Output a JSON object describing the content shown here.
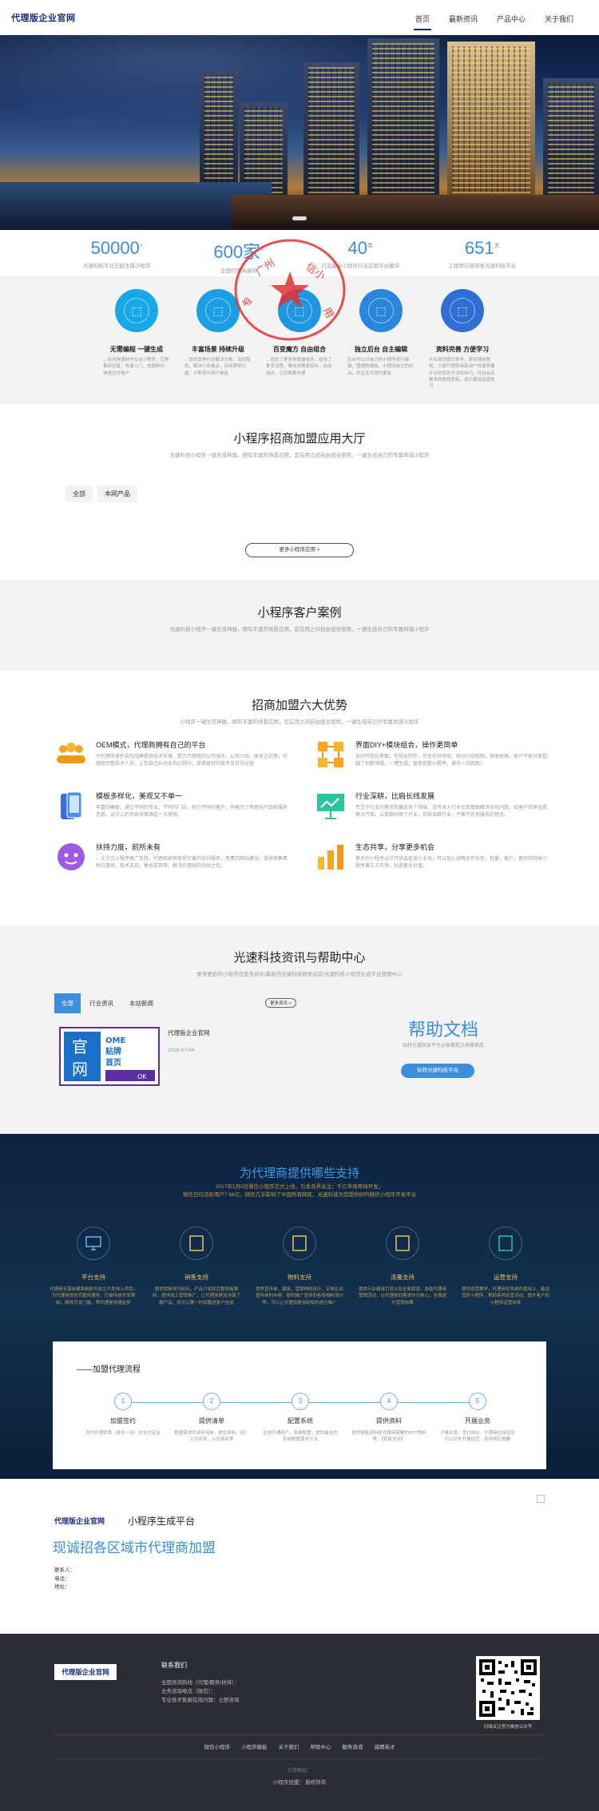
{
  "header": {
    "logo": "代理版企业官网",
    "nav": [
      "首页",
      "最新资讯",
      "产品中心",
      "关于我们"
    ]
  },
  "stats": [
    {
      "num": "50000",
      "sup": "+",
      "desc": "光速科技平台已经生成小程序"
    },
    {
      "num": "600家",
      "sup": "+",
      "desc": "全国代理商遍布"
    },
    {
      "num": "40",
      "sup": "类",
      "desc": "打造最全小程序行业应用平台模块"
    },
    {
      "num": "651",
      "sup": "天",
      "desc": "工程师日夜研发光速科技平台"
    }
  ],
  "features": [
    {
      "title": "无需编程 一键生成",
      "desc": "，在线快速制作生成小程序，完美集现设备；快速入门，快速制作，快速交付客户",
      "color": "#18a8e8"
    },
    {
      "title": "丰富场景 持续升级",
      "desc": "，提供百种行业解决方案，深挖需求，解决行业痛点，持续更新功能，不断提升用户体验",
      "color": "#1a9ee6"
    },
    {
      "title": "百变魔方 自由组合",
      "desc": "，提供了更多更便捷组件，提供了更多设置，模块间随意组合，自由组合，让页面更丰满",
      "color": "#2196e0"
    },
    {
      "title": "独立后台 自主编辑",
      "desc": "后台可以对自己的小程序进行编辑，管理的编辑，小程序独立的后台，并且在可随时更新",
      "color": "#2a86dc"
    },
    {
      "title": "资料完善 方便学习",
      "desc": "不仅提供图文教学，更有视频教程，方便代理和商家用户快速掌握平台的使用方法和技巧，并且会有更多的教程更新，成功使用运营技巧",
      "color": "#2f6fd4"
    }
  ],
  "seal": {
    "top": "广州信小",
    "bottom": "专用章"
  },
  "app_hall": {
    "title": "小程序招商加盟应用大厅",
    "subtitle": "光速科技小程序一键生成神器，拥有丰富的场景应用，您在用之间自由组合使用，一键生成自己的专属商城小程序",
    "tabs": [
      "全部",
      "本网产品"
    ],
    "more": "更多小程序应用 >"
  },
  "cases": {
    "title": "小程序客户案例",
    "subtitle": "光速科技小程序一键生成神器，拥有丰富的场景应用，您在用之间自由组合使用，一键生成自己的专属商城小程序"
  },
  "advantages": {
    "title": "招商加盟六大优势",
    "subtitle": "小程序一键生成神器，拥有丰富的场景应用，您在用之间自由组合使用，一键生成自己的专属商城小程序",
    "items": [
      {
        "title": "OEM模式，代理商拥有自己的平台",
        "desc": "为代理商保护自我品牌提供技术支撑，提示代理商的公司域名，公司介绍，联系方式等，代理商完整技术人员，让您自己从创业的过程中，获得更好的技术支持与运营",
        "icon": "users-icon"
      },
      {
        "title": "界面DIY+模块组合，操作更简单",
        "desc": "自创可视化界面，可视化制作，完全实时预览，拖动分组机制，快速拖拽，客户不能分享超越了创新领域，一键生成，智能搭配小程序，操作一站到底！",
        "icon": "modules-icon"
      },
      {
        "title": "模板多样化，美观又不单一",
        "desc": "丰富的模板，通过不同的专业，不同的门店，吸引不同的客户，并展示了两者的产品和服务信息。设计上的布局多面满足一大美观。",
        "icon": "mobile-template-icon"
      },
      {
        "title": "行业深耕，比肩长线发展",
        "desc": "专注于行业的需求和痛点各个领域，没有深入行业优良基础解决实际问题，给客户带来优质解决方案。认真做好每个行业，持续深耕行业，不懈不怠地服务的理念。",
        "icon": "presentation-icon"
      },
      {
        "title": "扶持力度，前所未有",
        "desc": "，全方位小程序推广支持，代理商能够享受完善的培训服务，免费的网站建设，提供销售素材与营销，技术支持，售后支持等。解决代理商的后顾之忧。",
        "icon": "support-agent-icon"
      },
      {
        "title": "生态共享，分享更多机会",
        "desc": "更多的小程序设计开放会促进小业务，可以加入战略合作伙伴，批量，客户，更好的持续小程序第三方市场，创造更多价值。",
        "icon": "growth-chart-icon"
      }
    ]
  },
  "news": {
    "title": "光速科技资讯与帮助中心",
    "subtitle": "更多更新的小程序信息告诉你/最新的光速科技研发动态/光速科技小程序生成平台使用中心",
    "tabs": [
      "全部",
      "行业资讯",
      "本站新闻"
    ],
    "more": "更多资讯 >",
    "card": {
      "image_text": [
        "官",
        "网",
        "OME",
        "贴牌",
        "首页",
        "OK"
      ],
      "title": "代理版企业官网",
      "date": "2018-07-04"
    },
    "help": {
      "title": "帮助文档",
      "subtitle": "玩转光速科技平台必备教程文档搜索库",
      "button": "玩转光速科技平台"
    }
  },
  "agent_support": {
    "title": "为代理商提供哪些支持",
    "subtitle_lines": [
      "2017年1月9日微信小程序正式上线，引发各界关注；千亿市场等待开发，",
      "微信日均活跃用户7.68亿，微信几乎影响了中国所有网民，光速科技为您提供好的微信小程序开发平台"
    ],
    "items": [
      {
        "title": "平台支持",
        "desc": "代理商无需自建系统即可自主开发线上项目，为代理商提供完整的服务，打破传统开发限制，降低开发门槛，帮代理商快速起步",
        "icon": "monitor-icon"
      },
      {
        "title": "销售支持",
        "desc": "提供销售技巧培训，产品介绍和完整销售物料，提供线上营销推广，让代理商更加全面了解产品，并可以第一时间跟进客户信息",
        "icon": "chart-card-icon"
      },
      {
        "title": "物料支持",
        "desc": "提供宣传单、展架、营销物料设计，定制企业宣传册的内容，提供推广宣传的各类物料设计等，可以让代理商更加轻松的进行推广",
        "icon": "document-icon"
      },
      {
        "title": "流量支持",
        "desc": "提供行业精准引流以及全面资源，协助代理商营销活动，以代理商的需求作为核心，全面提升营销效果",
        "icon": "traffic-icon"
      },
      {
        "title": "运营支持",
        "desc": "提供运营教学，代理商在系统的使用上，能运营好小程序，帮助各项运营活动，提升客户的小程序运营效率",
        "icon": "gear-icon"
      }
    ],
    "process": {
      "title": "——加盟代理流程",
      "steps": [
        {
          "num": "1",
          "title": "加盟签约",
          "desc": "签约代理政策（身份一份）并支付定金"
        },
        {
          "num": "2",
          "title": "提供清单",
          "desc": "根据需求的资料清单，提交资料，如：公司名称，公司域名等"
        },
        {
          "num": "3",
          "title": "配置系统",
          "desc": "在线开通账户，系统配置，提供最全的系统配置使用方法"
        },
        {
          "num": "4",
          "title": "提供资料",
          "desc": "提供销售资料和代理商需要的PPT物料等，【销售支持】"
        },
        {
          "num": "5",
          "title": "开展业务",
          "desc": "开展业务，签约协议，代理商在授权后可以对外开展经营，获得相应报酬"
        }
      ]
    }
  },
  "recruit": {
    "logo": "代理版企业官网",
    "platform": "小程序生成平台",
    "title": "现诚招各区域市代理商加盟",
    "contact": [
      "联系人：",
      "电话：",
      "地址："
    ]
  },
  "footer": {
    "logo": "代理版企业官网",
    "contact_title": "联系我们",
    "contact_lines": [
      "全国咨询热线（代理/服务/扶持）：",
      "业务咨询电话（微信）：",
      "专业技术售服在线问题：立即咨询"
    ],
    "qr_caption": "扫描关注官方微信公众号",
    "links": [
      "微信小程序",
      "小程序模板",
      "关于我们",
      "帮助中心",
      "服务咨询",
      "诚聘英才"
    ],
    "address": "公司地址：",
    "copyright": "小程序加盟： 版权所有"
  }
}
